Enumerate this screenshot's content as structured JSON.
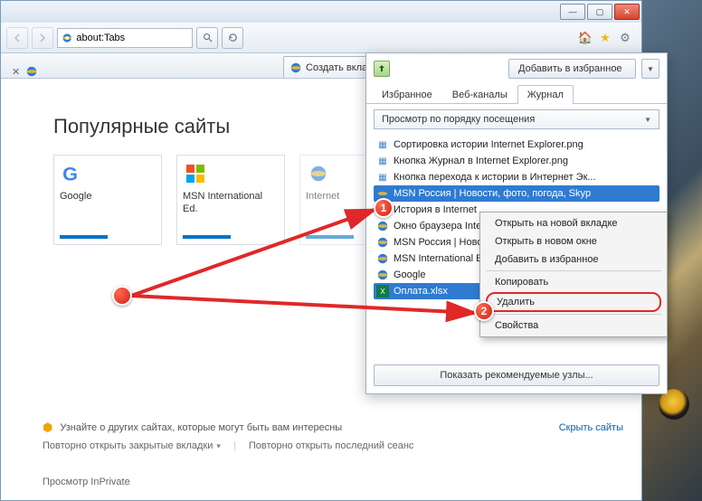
{
  "window": {
    "min": "—",
    "max": "▢",
    "close": "✕"
  },
  "nav": {
    "address": "about:Tabs",
    "tab_title": "Создать вкладку"
  },
  "toolbar_icons": {
    "home": "🏠",
    "star": "★",
    "gear": "⚙"
  },
  "page": {
    "heading": "Популярные сайты",
    "tiles": [
      {
        "label": "Google",
        "icon": "G"
      },
      {
        "label": "MSN International Ed.",
        "icon": "MS"
      },
      {
        "label": "Internet",
        "icon": "IE"
      }
    ],
    "footer_tip": "Узнайте о других сайтах, которые могут быть вам интересны",
    "hide_sites": "Скрыть сайты",
    "reopen_closed": "Повторно открыть закрытые вкладки",
    "reopen_last": "Повторно открыть последний сеанс",
    "inprivate": "Просмотр InPrivate"
  },
  "fav": {
    "add_btn": "Добавить в избранное",
    "tabs": [
      "Избранное",
      "Веб-каналы",
      "Журнал"
    ],
    "sort_label": "Просмотр по порядку посещения",
    "items": [
      {
        "t": "img",
        "label": "Сортировка истории Internet Explorer.png"
      },
      {
        "t": "img",
        "label": "Кнопка Журнал в Internet Explorer.png"
      },
      {
        "t": "img",
        "label": "Кнопка перехода к истории в Интернет Эк..."
      },
      {
        "t": "ie",
        "label": "MSN Россия | Новости, фото, погода, Skyp",
        "sel": true
      },
      {
        "t": "ie",
        "label": "История в Internet"
      },
      {
        "t": "ie",
        "label": "Окно браузера Inte"
      },
      {
        "t": "ie",
        "label": "MSN Россия | Ново"
      },
      {
        "t": "ie",
        "label": "MSN International E"
      },
      {
        "t": "ie",
        "label": "Google"
      },
      {
        "t": "xl",
        "label": "Оплата.xlsx",
        "sel": true
      }
    ],
    "show_rec": "Показать рекомендуемые узлы..."
  },
  "ctx": {
    "open_new_tab": "Открыть на новой вкладке",
    "open_new_win": "Открыть в новом окне",
    "add_fav": "Добавить в избранное",
    "copy": "Копировать",
    "delete": "Удалить",
    "props": "Свойства"
  },
  "markers": {
    "m1": "1",
    "m2": "2"
  }
}
